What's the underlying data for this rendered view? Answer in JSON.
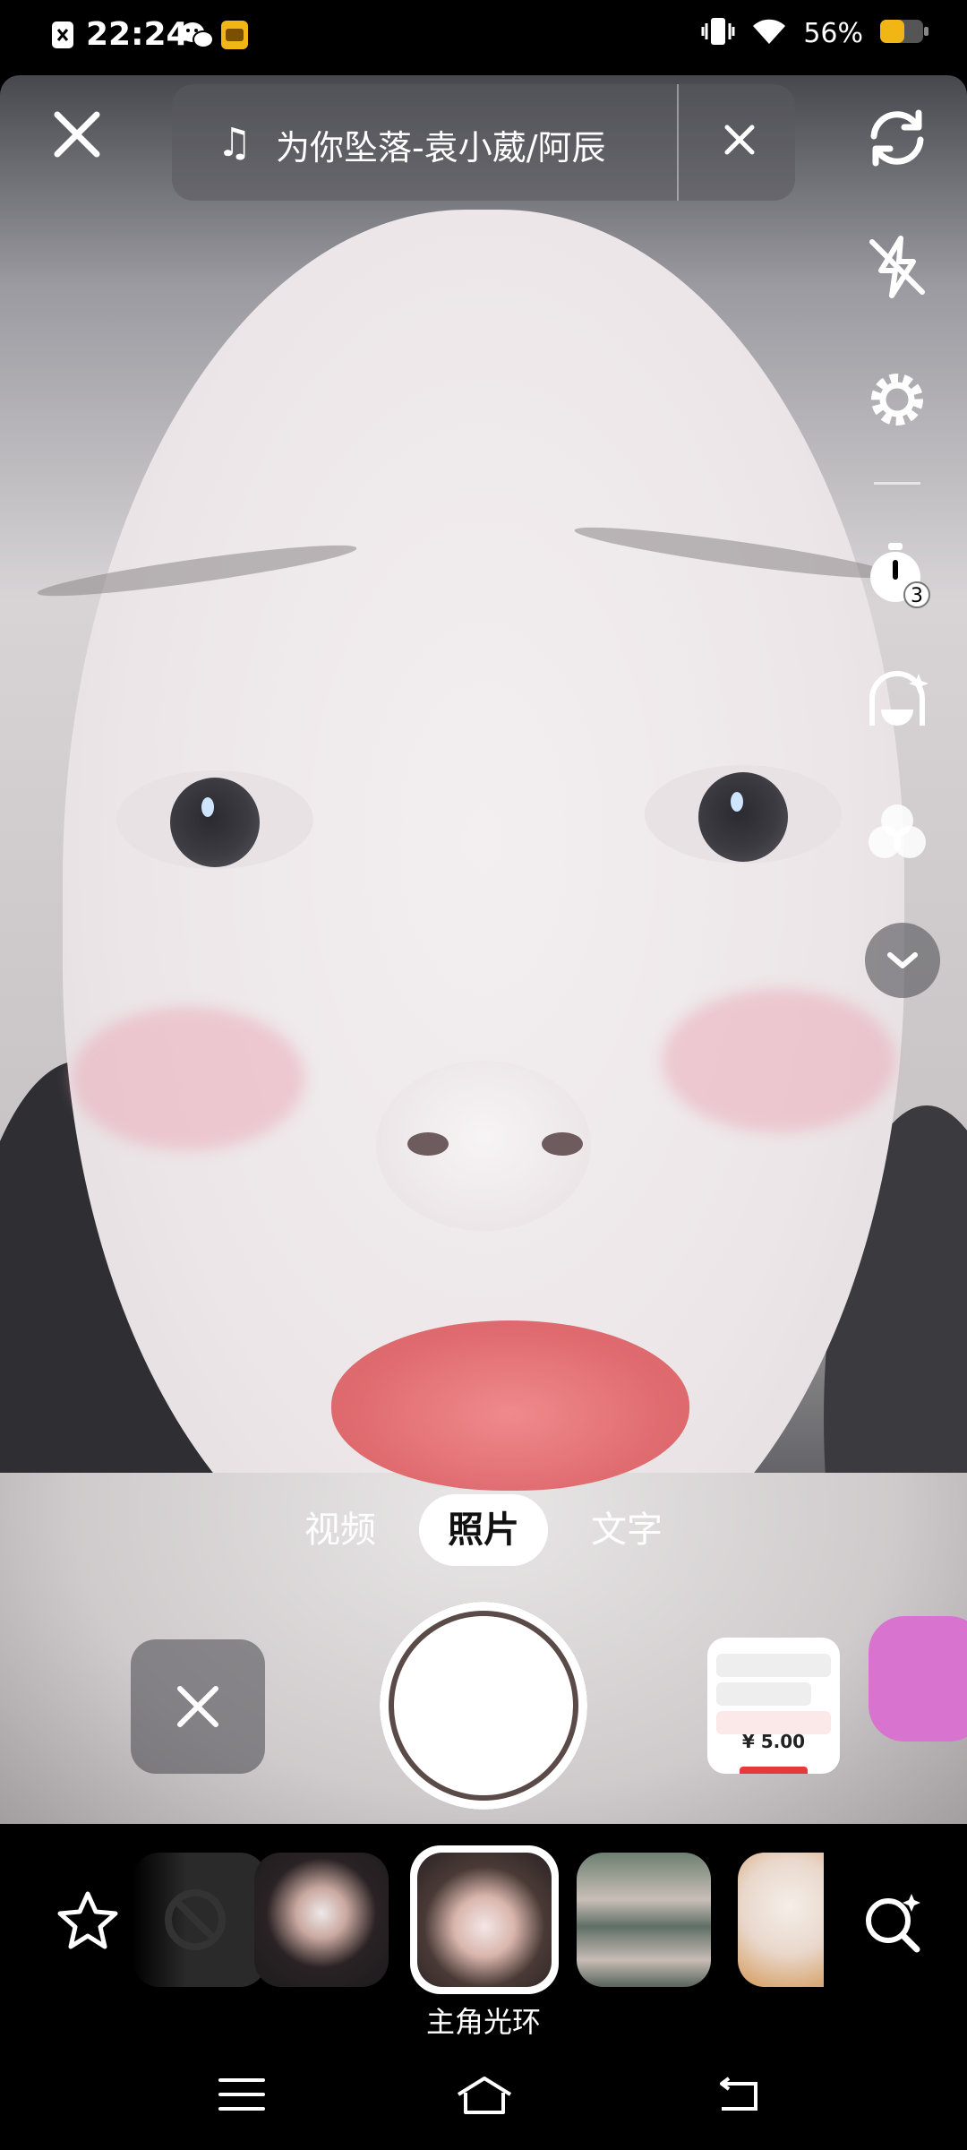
{
  "status_bar": {
    "time": "22:24",
    "battery": "56%"
  },
  "music": {
    "note_icon": "music-note-icon",
    "title": "为你坠落-袁小葳/阿辰"
  },
  "side_tools": [
    "switch-camera-icon",
    "flash-off-icon",
    "settings-icon",
    "timer-icon",
    "beauty-icon",
    "filter-icon",
    "chevron-down-icon"
  ],
  "timer_badge": "3",
  "modes": {
    "items": [
      "视频",
      "照片",
      "文字"
    ],
    "active": "照片"
  },
  "recent_thumb": {
    "amount": "¥ 5.00"
  },
  "effects": {
    "selected_label": "主角光环"
  },
  "colors": {
    "accent_red": "#e43a3a",
    "chip_bg": "#ffffff"
  }
}
